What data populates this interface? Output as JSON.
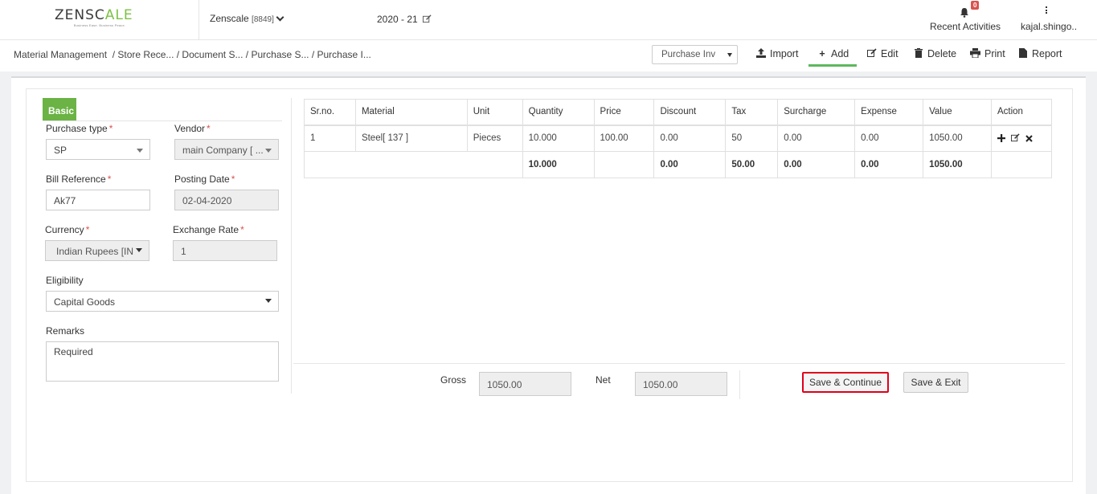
{
  "header": {
    "logo": {
      "text_main": "ZENSC",
      "text_accent": "ALE",
      "tagline": "Business Ease. Business Peace."
    },
    "company": {
      "name": "Zenscale",
      "code": "[8849]"
    },
    "fiscal_year": "2020 - 21",
    "recent_activities": {
      "label": "Recent Activities",
      "badge": "0"
    },
    "user": "kajal.shingo.."
  },
  "breadcrumb": {
    "root": "Material Management",
    "path": "/ Store Rece... / Document S... / Purchase S... / Purchase I..."
  },
  "toolbar": {
    "doc_type": "Purchase Inv",
    "import": "Import",
    "add": "Add",
    "edit": "Edit",
    "delete": "Delete",
    "print": "Print",
    "report": "Report"
  },
  "form": {
    "tab": "Basic",
    "purchase_type": {
      "label": "Purchase type",
      "value": "SP"
    },
    "vendor": {
      "label": "Vendor",
      "value": "main Company [ ..."
    },
    "bill_reference": {
      "label": "Bill Reference",
      "value": "Ak77"
    },
    "posting_date": {
      "label": "Posting Date",
      "value": "02-04-2020"
    },
    "currency": {
      "label": "Currency",
      "value": "Indian Rupees [IN"
    },
    "exchange_rate": {
      "label": "Exchange Rate",
      "value": "1"
    },
    "eligibility": {
      "label": "Eligibility",
      "value": "Capital Goods"
    },
    "remarks": {
      "label": "Remarks",
      "value": "Required"
    }
  },
  "table": {
    "columns": [
      "Sr.no.",
      "Material",
      "Unit",
      "Quantity",
      "Price",
      "Discount",
      "Tax",
      "Surcharge",
      "Expense",
      "Value",
      "Action"
    ],
    "rows": [
      {
        "sr": "1",
        "material": "Steel[ 137 ]",
        "unit": "Pieces",
        "quantity": "10.000",
        "price": "100.00",
        "discount": "0.00",
        "tax": "50",
        "surcharge": "0.00",
        "expense": "0.00",
        "value": "1050.00"
      }
    ],
    "totals": {
      "quantity": "10.000",
      "discount": "0.00",
      "tax": "50.00",
      "surcharge": "0.00",
      "expense": "0.00",
      "value": "1050.00"
    },
    "action_icons": [
      "plus-icon",
      "edit-icon",
      "close-icon"
    ]
  },
  "summary": {
    "gross_label": "Gross",
    "gross_value": "1050.00",
    "net_label": "Net",
    "net_value": "1050.00"
  },
  "buttons": {
    "save_continue": "Save & Continue",
    "save_exit": "Save & Exit"
  },
  "colors": {
    "accent_green": "#6ab344",
    "required_red": "#d9534f",
    "highlight_red": "#e0001a"
  }
}
